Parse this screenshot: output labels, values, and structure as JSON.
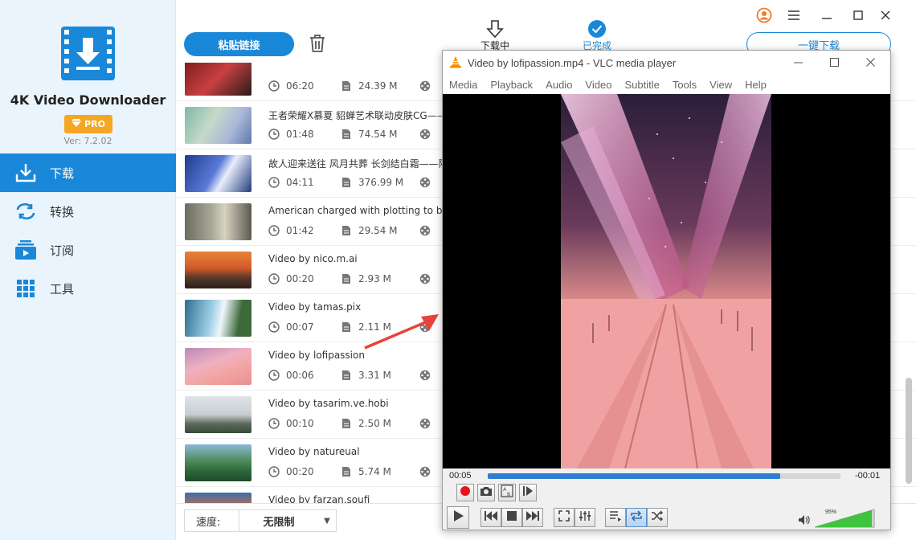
{
  "app": {
    "name": "4K Video Downloader",
    "pro_label": "PRO",
    "version": "Ver: 7.2.02"
  },
  "sidebar": {
    "items": [
      {
        "label": "下载",
        "icon": "download-icon",
        "active": true
      },
      {
        "label": "转换",
        "icon": "convert-icon",
        "active": false
      },
      {
        "label": "订阅",
        "icon": "subscribe-icon",
        "active": false
      },
      {
        "label": "工具",
        "icon": "tools-icon",
        "active": false
      }
    ]
  },
  "toolbar": {
    "paste_label": "粘贴链接",
    "tab_downloading": "下载中",
    "tab_done": "已完成",
    "onekey_label": "一键下载"
  },
  "list": {
    "rows": [
      {
        "title": "",
        "duration": "06:20",
        "size": "24.39 M"
      },
      {
        "title": "王者荣耀X慕夏  貂蝉艺术联动皮肤CG——",
        "duration": "01:48",
        "size": "74.54 M"
      },
      {
        "title": "故人迎来送往 风月共葬 长剑结白霜——陵",
        "duration": "04:11",
        "size": "376.99 M"
      },
      {
        "title": "American charged with plotting to bom",
        "duration": "01:42",
        "size": "29.54 M"
      },
      {
        "title": "Video by nico.m.ai",
        "duration": "00:20",
        "size": "2.93 M"
      },
      {
        "title": "Video by tamas.pix",
        "duration": "00:07",
        "size": "2.11 M"
      },
      {
        "title": "Video by lofipassion",
        "duration": "00:06",
        "size": "3.31 M"
      },
      {
        "title": "Video by tasarim.ve.hobi",
        "duration": "00:10",
        "size": "2.50 M"
      },
      {
        "title": "Video by natureual",
        "duration": "00:20",
        "size": "5.74 M"
      },
      {
        "title": "Video by farzan.soufi",
        "duration": "",
        "size": ""
      }
    ]
  },
  "bottom": {
    "speed_label": "速度:",
    "speed_value": "无限制"
  },
  "vlc": {
    "title": "Video by lofipassion.mp4 - VLC media player",
    "menu": [
      "Media",
      "Playback",
      "Audio",
      "Video",
      "Subtitle",
      "Tools",
      "View",
      "Help"
    ],
    "elapsed": "00:05",
    "remaining": "-00:01",
    "progress": 0.83,
    "volume_text": "95%",
    "volume": 0.95
  },
  "colors": {
    "accent": "#1a88d8",
    "pro": "#f5a623",
    "vlc_orange": "#f28c00",
    "annotation_arrow": "#e8433a"
  }
}
